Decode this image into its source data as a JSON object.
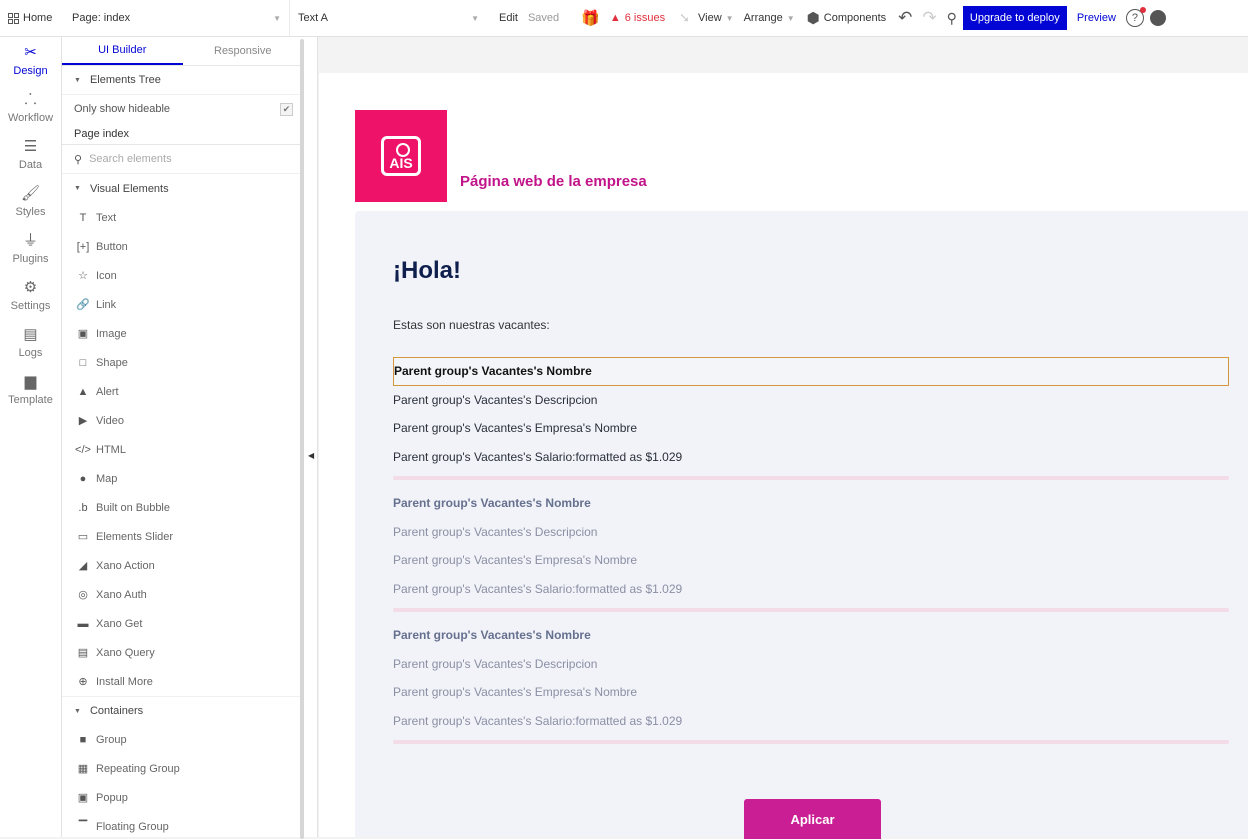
{
  "topbar": {
    "home": "Home",
    "page_selector": "Page: index",
    "element_selector": "Text A",
    "edit": "Edit",
    "saved": "Saved",
    "issues": "6 issues",
    "view": "View",
    "arrange": "Arrange",
    "components": "Components",
    "upgrade": "Upgrade to deploy",
    "preview": "Preview",
    "help": "?"
  },
  "rail": {
    "items": [
      {
        "label": "Design",
        "icon": "design-icon"
      },
      {
        "label": "Workflow",
        "icon": "workflow-icon"
      },
      {
        "label": "Data",
        "icon": "database-icon"
      },
      {
        "label": "Styles",
        "icon": "brush-icon"
      },
      {
        "label": "Plugins",
        "icon": "plug-icon"
      },
      {
        "label": "Settings",
        "icon": "gear-icon"
      },
      {
        "label": "Logs",
        "icon": "document-icon"
      },
      {
        "label": "Template",
        "icon": "template-icon"
      }
    ]
  },
  "panel": {
    "tabs": [
      "UI Builder",
      "Responsive"
    ],
    "elements_tree": "Elements Tree",
    "only_hideable": "Only show hideable",
    "page_index": "Page index",
    "search_placeholder": "Search elements",
    "visual_elements": "Visual Elements",
    "visual_items": [
      {
        "label": "Text",
        "icon": "T"
      },
      {
        "label": "Button",
        "icon": "[+]"
      },
      {
        "label": "Icon",
        "icon": "☆"
      },
      {
        "label": "Link",
        "icon": "🔗"
      },
      {
        "label": "Image",
        "icon": "▣"
      },
      {
        "label": "Shape",
        "icon": "□"
      },
      {
        "label": "Alert",
        "icon": "▲"
      },
      {
        "label": "Video",
        "icon": "▶"
      },
      {
        "label": "HTML",
        "icon": "</>"
      },
      {
        "label": "Map",
        "icon": "●"
      },
      {
        "label": "Built on Bubble",
        "icon": ".b"
      },
      {
        "label": "Elements Slider",
        "icon": "▭"
      },
      {
        "label": "Xano Action",
        "icon": "◢"
      },
      {
        "label": "Xano Auth",
        "icon": "◎"
      },
      {
        "label": "Xano Get",
        "icon": "▬"
      },
      {
        "label": "Xano Query",
        "icon": "▤"
      },
      {
        "label": "Install More",
        "icon": "⊕"
      }
    ],
    "containers": "Containers",
    "container_items": [
      {
        "label": "Group",
        "icon": "■"
      },
      {
        "label": "Repeating Group",
        "icon": "▦"
      },
      {
        "label": "Popup",
        "icon": "▣"
      },
      {
        "label": "Floating Group",
        "icon": "▔"
      }
    ]
  },
  "canvas": {
    "site_title": "Página web de la empresa",
    "logo_text": "AIS",
    "greeting": "¡Hola!",
    "intro": "Estas son nuestras vacantes:",
    "cells": [
      {
        "name": "Parent group's Vacantes's Nombre",
        "description": "Parent group's Vacantes's Descripcion",
        "company": "Parent group's Vacantes's Empresa's Nombre",
        "salary": "Parent group's Vacantes's Salario:formatted as $1.029"
      },
      {
        "name": "Parent group's Vacantes's Nombre",
        "description": "Parent group's Vacantes's Descripcion",
        "company": "Parent group's Vacantes's Empresa's Nombre",
        "salary": "Parent group's Vacantes's Salario:formatted as $1.029"
      },
      {
        "name": "Parent group's Vacantes's Nombre",
        "description": "Parent group's Vacantes's Descripcion",
        "company": "Parent group's Vacantes's Empresa's Nombre",
        "salary": "Parent group's Vacantes's Salario:formatted as $1.029"
      }
    ],
    "apply_button": "Aplicar"
  },
  "colors": {
    "accent": "#0205d3",
    "brand_pink": "#ee1369",
    "title_magenta": "#c1148a",
    "button": "#c91e94",
    "issues_red": "#e0303c"
  }
}
